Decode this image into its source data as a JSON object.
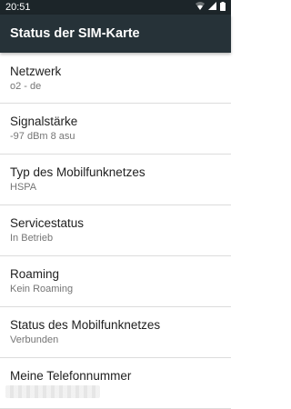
{
  "status_bar": {
    "time": "20:51",
    "icons": [
      "wifi-icon",
      "signal-icon",
      "battery-icon"
    ]
  },
  "app_bar": {
    "title": "Status der SIM-Karte"
  },
  "items": [
    {
      "title": "Netzwerk",
      "summary": "o2 - de"
    },
    {
      "title": "Signalstärke",
      "summary": "-97 dBm 8 asu"
    },
    {
      "title": "Typ des Mobilfunknetzes",
      "summary": "HSPA"
    },
    {
      "title": "Servicestatus",
      "summary": "In Betrieb"
    },
    {
      "title": "Roaming",
      "summary": "Kein Roaming"
    },
    {
      "title": "Status des Mobilfunknetzes",
      "summary": "Verbunden"
    },
    {
      "title": "Meine Telefonnummer",
      "summary": ""
    }
  ],
  "colors": {
    "status_bar_bg": "#1c2529",
    "app_bar_bg": "#263238",
    "title_text": "#212121",
    "summary_text": "#757575",
    "divider": "#dcdcdc"
  }
}
